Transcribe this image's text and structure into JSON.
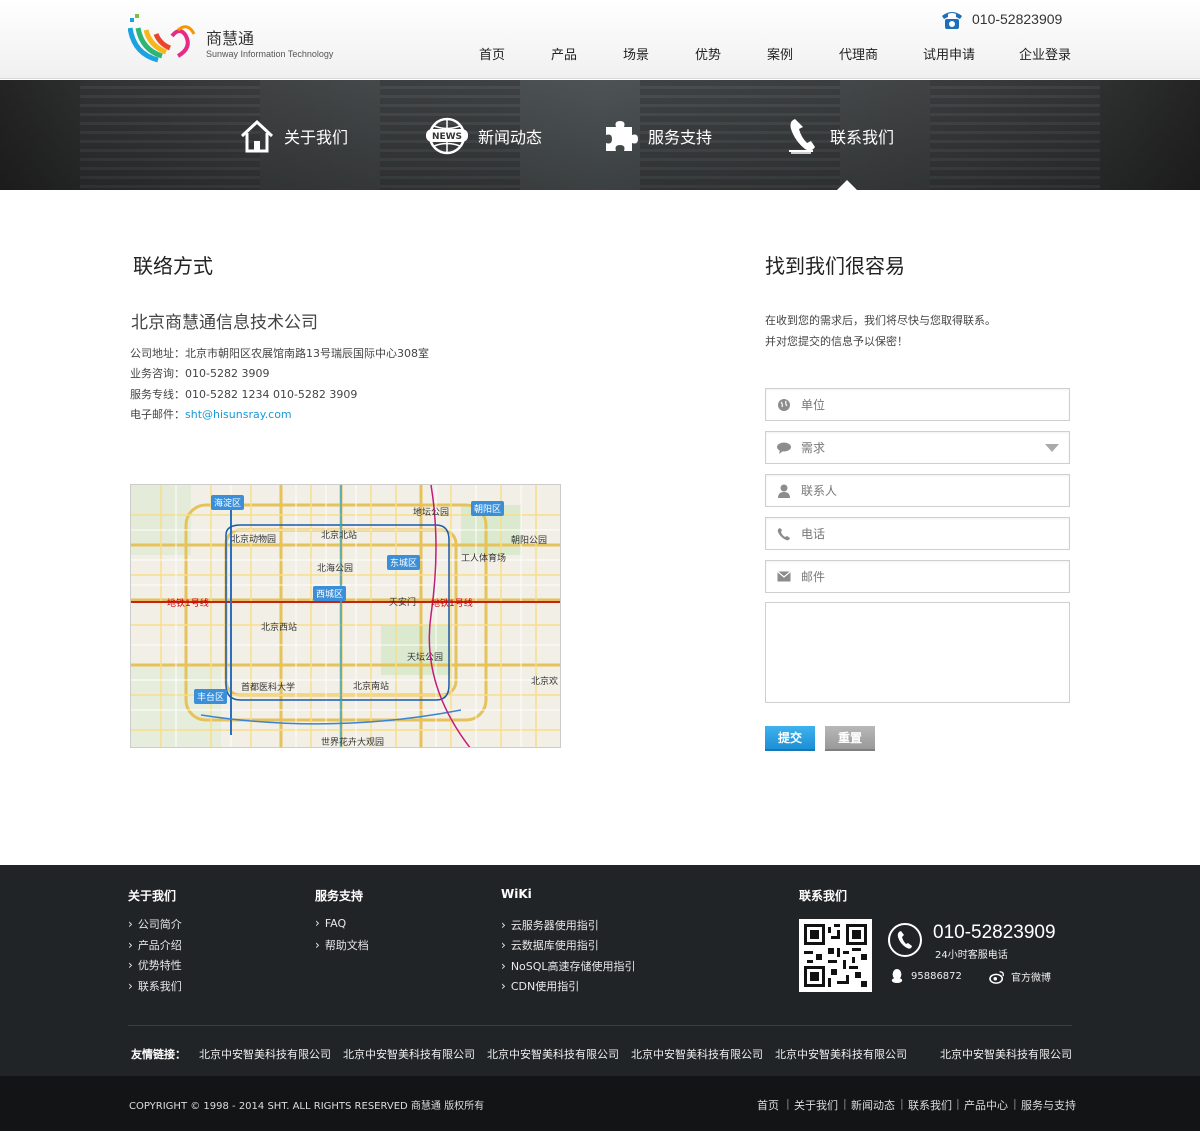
{
  "header": {
    "brand_name": "商慧通",
    "brand_sub": "Sunway Information Technology",
    "phone": "010-52823909",
    "nav": [
      "首页",
      "产品",
      "场景",
      "优势",
      "案例",
      "代理商",
      "试用申请",
      "企业登录"
    ]
  },
  "banner": {
    "items": [
      {
        "label": "关于我们",
        "icon": "house-icon"
      },
      {
        "label": "新闻动态",
        "icon": "news-globe-icon"
      },
      {
        "label": "服务支持",
        "icon": "puzzle-icon"
      },
      {
        "label": "联系我们",
        "icon": "telephone-icon"
      }
    ],
    "active": "联系我们"
  },
  "contact": {
    "heading": "联络方式",
    "company": "北京商慧通信息技术公司",
    "address_label": "公司地址：",
    "address": "北京市朝阳区农展馆南路13号瑞辰国际中心308室",
    "consult_label": "业务咨询：",
    "consult": "010-5282 3909",
    "service_label": "服务专线：",
    "service": "010-5282 1234  010-5282 3909",
    "email_label": "电子邮件：",
    "email": "sht@hisunsray.com"
  },
  "map": {
    "districts": [
      "海淀区",
      "朝阳区",
      "东城区",
      "西城区",
      "丰台区"
    ],
    "places": [
      "北京动物园",
      "北京北站",
      "地坛公园",
      "朝阳公园",
      "工人体育场",
      "北海公园",
      "天安门",
      "北京西站",
      "天坛公园",
      "首都医科大学",
      "北京南站",
      "北京欢",
      "世界花卉大观园"
    ],
    "lines": [
      "地铁1号线",
      "地铁1号线"
    ]
  },
  "form": {
    "heading": "找到我们很容易",
    "intro_line1": "在收到您的需求后，我们将尽快与您取得联系。",
    "intro_line2": "并对您提交的信息予以保密！",
    "unit_placeholder": "单位",
    "need_placeholder": "需求",
    "contact_placeholder": "联系人",
    "phone_placeholder": "电话",
    "email_placeholder": "邮件",
    "submit": "提交",
    "reset": "重置"
  },
  "footer": {
    "col1_title": "关于我们",
    "col1_links": [
      "公司简介",
      "产品介绍",
      "优势特性",
      "联系我们"
    ],
    "col2_title": "服务支持",
    "col2_links": [
      "FAQ",
      "帮助文档"
    ],
    "col3_title": "WiKi",
    "col3_links": [
      "云服务器使用指引",
      "云数据库使用指引",
      "NoSQL高速存储使用指引",
      "CDN使用指引"
    ],
    "col4_title": "联系我们",
    "tel": "010-52823909",
    "tel_sub": "24小时客服电话",
    "qq": "95886872",
    "weibo": "官方微博",
    "friends_label": "友情链接：",
    "friends": [
      "北京中安智美科技有限公司",
      "北京中安智美科技有限公司",
      "北京中安智美科技有限公司",
      "北京中安智美科技有限公司",
      "北京中安智美科技有限公司",
      "北京中安智美科技有限公司"
    ]
  },
  "bottom": {
    "copyright": "COPYRIGHT © 1998 - 2014 SHT. ALL RIGHTS RESERVED  商慧通 版权所有",
    "links": [
      "首页",
      "关于我们",
      "新闻动态",
      "联系我们",
      "产品中心",
      "服务与支持"
    ]
  },
  "colors": {
    "accent": "#1c8fd6",
    "footer_bg": "#212427",
    "bottom_bg": "#121416",
    "link": "#1a9ad6"
  }
}
